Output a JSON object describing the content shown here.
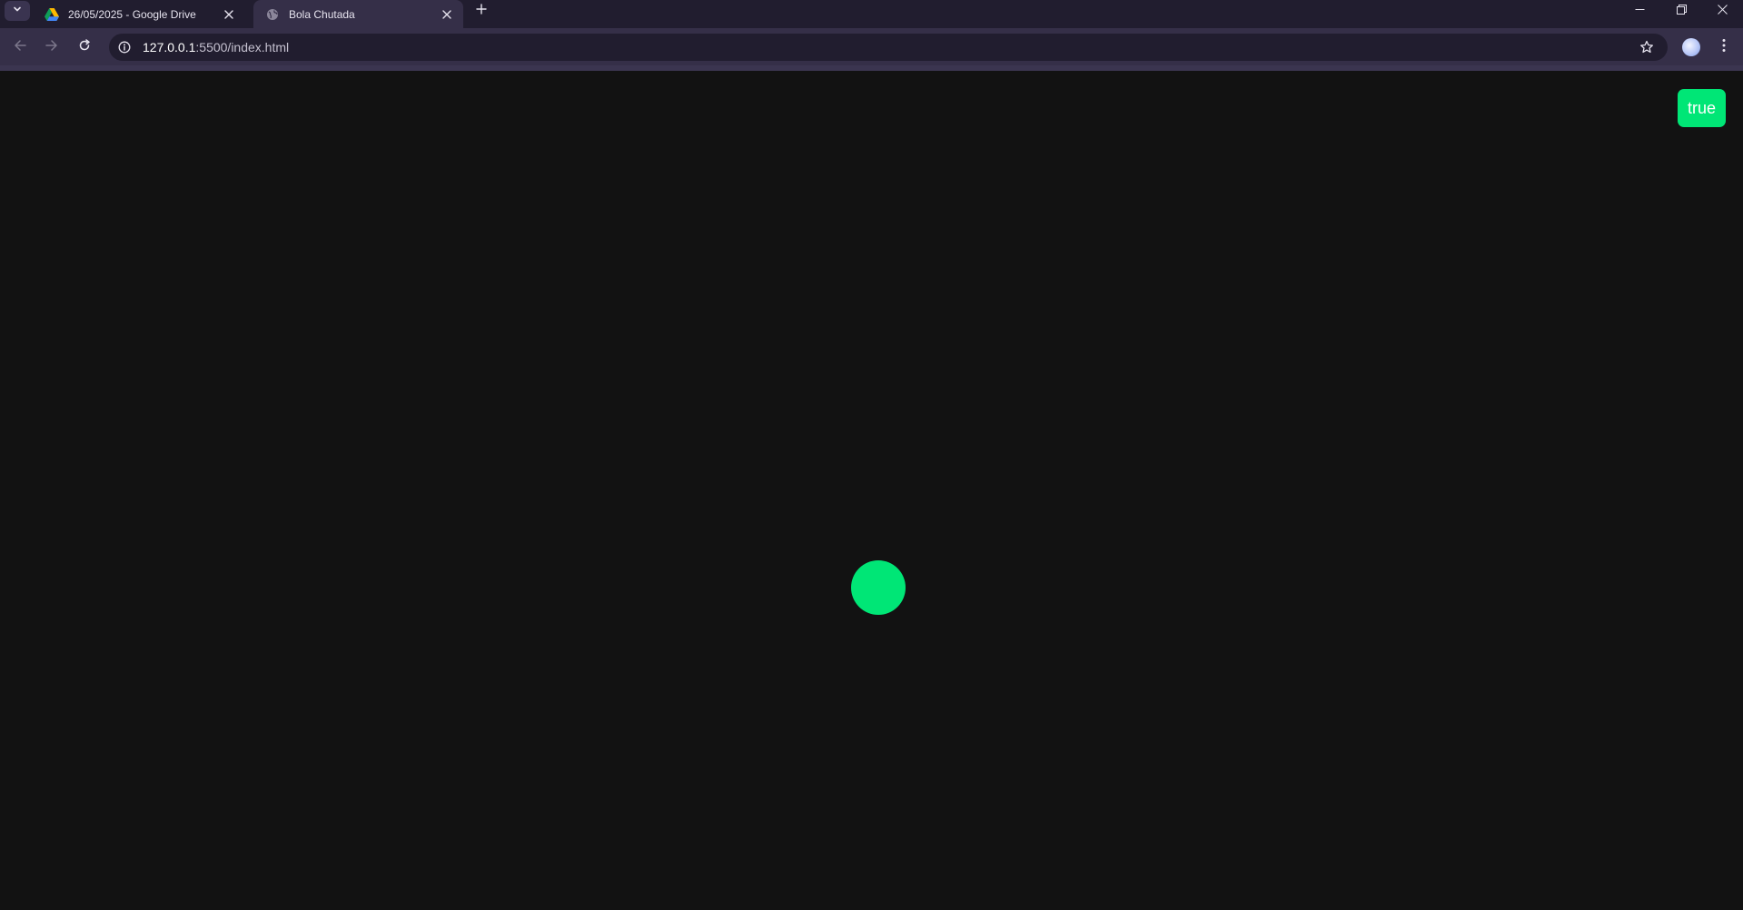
{
  "browser": {
    "tabs": [
      {
        "title": "26/05/2025 - Google Drive",
        "favicon": "google-drive-icon",
        "active": false
      },
      {
        "title": "Bola Chutada",
        "favicon": "globe-icon",
        "active": true
      }
    ],
    "address": {
      "host": "127.0.0.1",
      "path": ":5500/index.html"
    }
  },
  "page": {
    "status_label": "true",
    "accent_color": "#00e676",
    "background_color": "#121212"
  }
}
